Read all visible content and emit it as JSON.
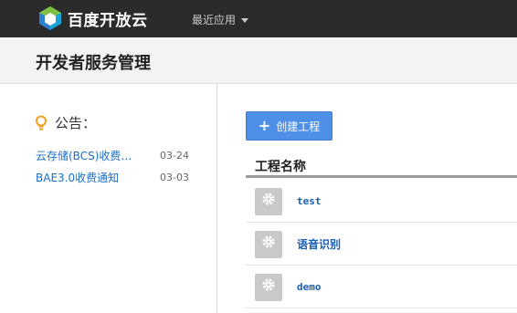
{
  "topbar": {
    "logo_text": "百度开放云",
    "logo_icon": "baidu-cloud-logo-icon",
    "recent_apps_label": "最近应用",
    "background": "#2b2b2b"
  },
  "page": {
    "title": "开发者服务管理"
  },
  "notices": {
    "label": "公告：",
    "icon": "lightbulb-icon",
    "items": [
      {
        "text": "云存储(BCS)收费…",
        "date": "03-24"
      },
      {
        "text": "BAE3.0收费通知",
        "date": "03-03"
      }
    ]
  },
  "projects": {
    "create_button_label": "创建工程",
    "create_button_icon": "plus-icon",
    "column_header": "工程名称",
    "thumb_icon": "gear-icon",
    "items": [
      {
        "name": "test"
      },
      {
        "name": "语音识别"
      },
      {
        "name": "demo"
      }
    ]
  },
  "colors": {
    "accent": "#4e8fe8",
    "link": "#1a6fc9"
  }
}
